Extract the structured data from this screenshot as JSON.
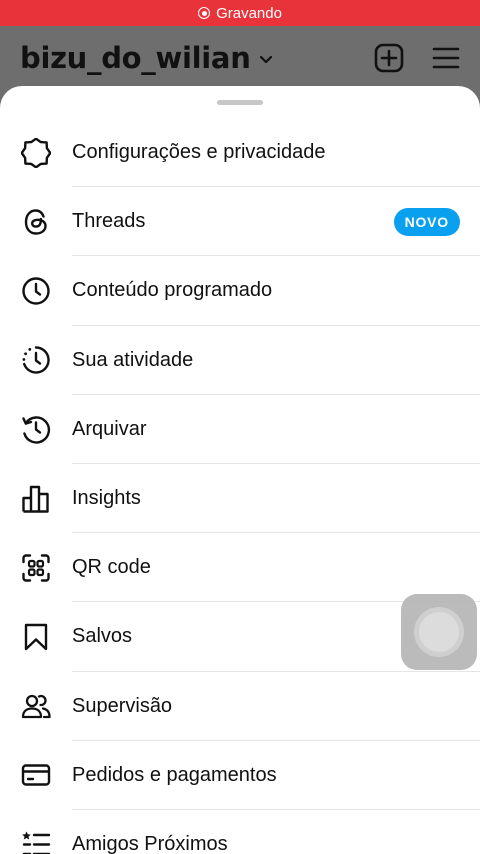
{
  "status_bar": {
    "recording_label": "Gravando",
    "color": "#e8333a"
  },
  "header": {
    "username": "bizu_do_wilian",
    "actions": [
      "plus-square-icon",
      "hamburger-menu-icon"
    ]
  },
  "menu": {
    "items": [
      {
        "label": "Configurações e privacidade",
        "icon": "gear-icon"
      },
      {
        "label": "Threads",
        "icon": "threads-icon",
        "badge": "NOVO"
      },
      {
        "label": "Conteúdo programado",
        "icon": "clock-icon"
      },
      {
        "label": "Sua atividade",
        "icon": "activity-icon"
      },
      {
        "label": "Arquivar",
        "icon": "archive-history-icon"
      },
      {
        "label": "Insights",
        "icon": "bar-chart-icon"
      },
      {
        "label": "QR code",
        "icon": "qr-code-icon"
      },
      {
        "label": "Salvos",
        "icon": "bookmark-icon"
      },
      {
        "label": "Supervisão",
        "icon": "supervision-icon"
      },
      {
        "label": "Pedidos e pagamentos",
        "icon": "credit-card-icon"
      },
      {
        "label": "Amigos Próximos",
        "icon": "close-friends-icon"
      }
    ],
    "badge_color": "#0aa0f0"
  }
}
